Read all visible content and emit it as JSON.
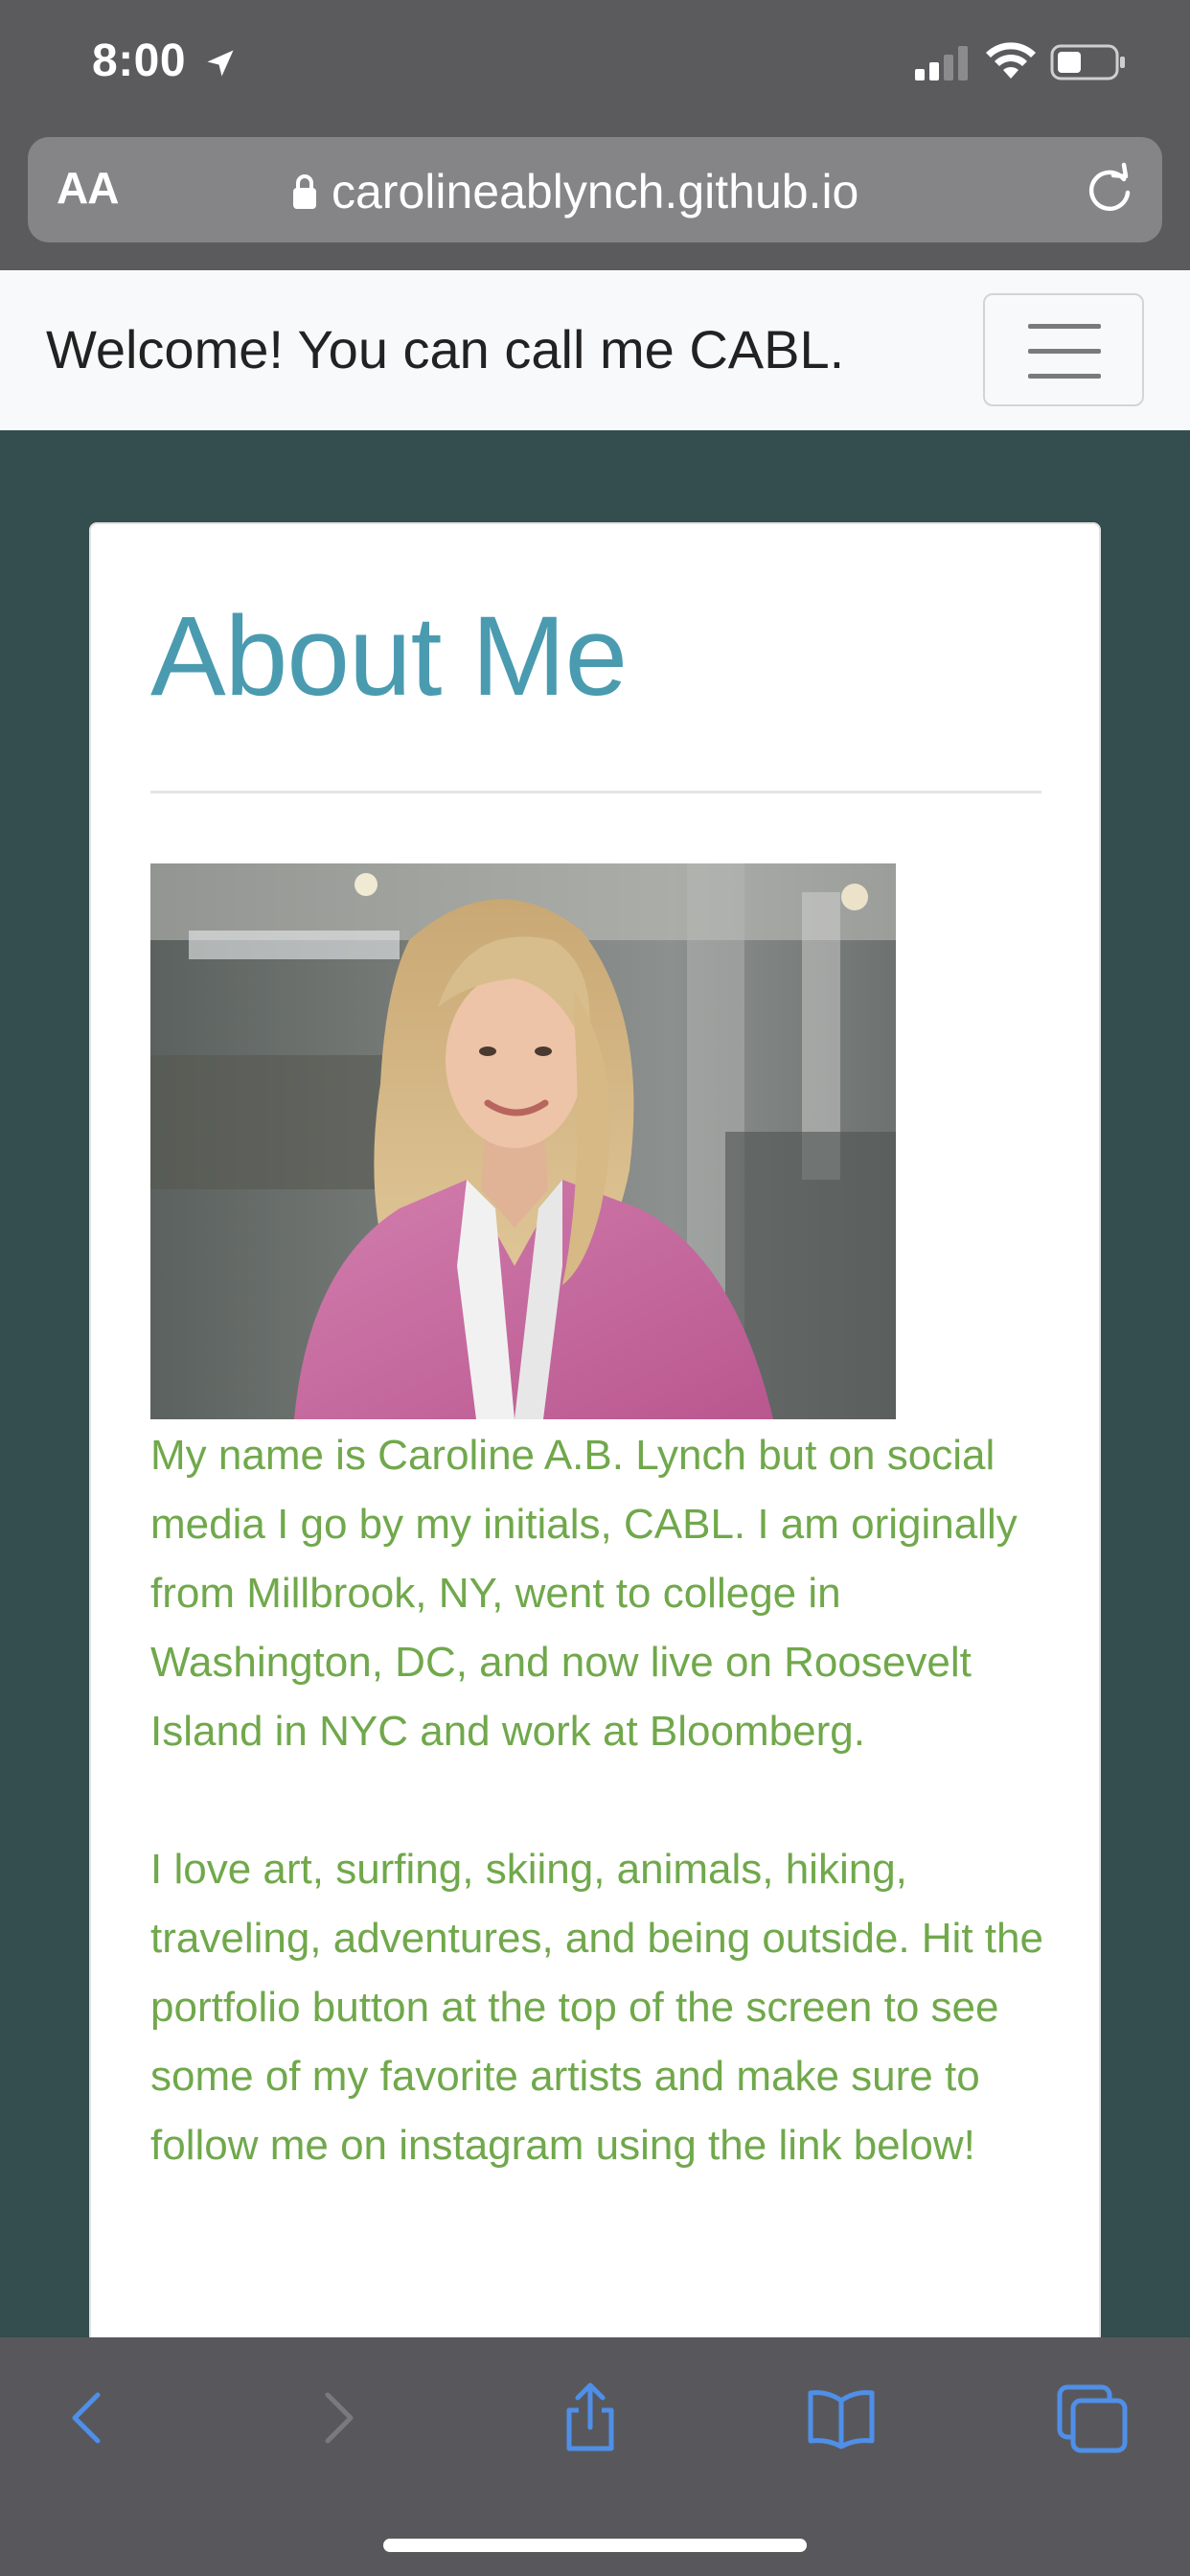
{
  "status_bar": {
    "time": "8:00",
    "icons": [
      "location-arrow-icon",
      "cellular-signal-icon",
      "wifi-icon",
      "battery-icon"
    ]
  },
  "safari": {
    "text_size_label": "AA",
    "url": "carolineablynch.github.io",
    "icons": [
      "lock-icon",
      "reload-icon"
    ],
    "toolbar": [
      "back-icon",
      "forward-icon",
      "share-icon",
      "bookmarks-icon",
      "tabs-icon"
    ]
  },
  "navbar": {
    "brand": "Welcome! You can call me CABL.",
    "toggler_icon": "hamburger-menu-icon"
  },
  "about": {
    "title": "About Me",
    "paragraphs": [
      "My name is Caroline A.B. Lynch but on social media I go by my initials, CABL. I am originally from Millbrook, NY, went to college in Washington, DC, and now live on Roosevelt Island in NYC and work at Bloomberg.",
      "I love art, surfing, skiing, animals, hiking, traveling, adventures, and being outside. Hit the portfolio button at the top of the screen to see some of my favorite artists and make sure to follow me on instagram using the link below!"
    ]
  },
  "colors": {
    "page_background": "#344d4e",
    "title": "#4a9bb0",
    "body_text": "#70a84b",
    "safari_chrome": "#5b5b5e",
    "toolbar_icon": "#4f8fe8"
  }
}
